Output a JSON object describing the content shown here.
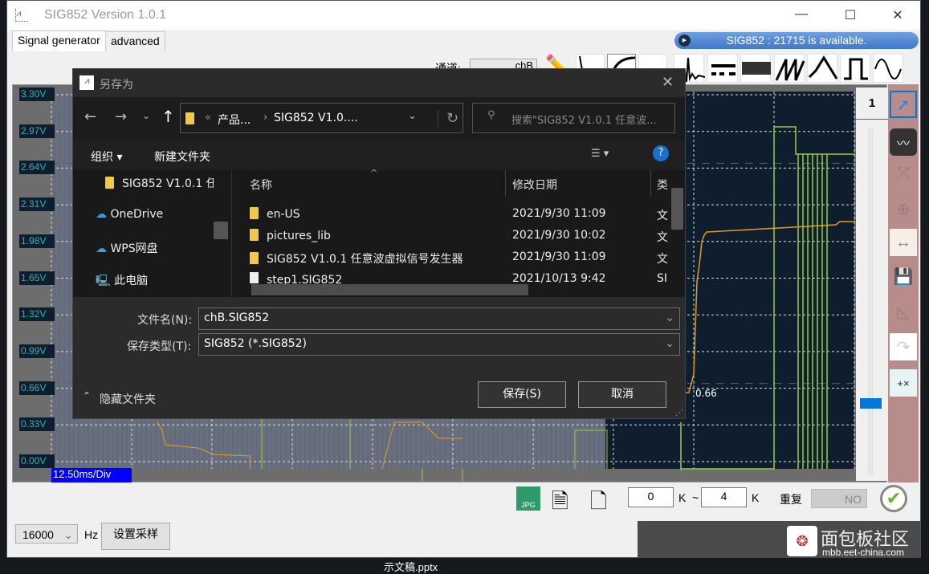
{
  "window": {
    "title": "SIG852  Version 1.0.1",
    "minimize": "—",
    "maximize": "☐",
    "close": "✕"
  },
  "tabs": [
    {
      "label": "Signal generator",
      "active": true
    },
    {
      "label": "advanced",
      "active": false
    }
  ],
  "banner": {
    "text": "SIG852 : 21715 is available."
  },
  "toolbar": {
    "channel_label": "通道:",
    "channel_value": "chB",
    "waveforms": [
      "noise-pulse",
      "dc",
      "noise",
      "sawtooth",
      "triangle",
      "square",
      "sine"
    ]
  },
  "chart": {
    "y_labels": [
      "3.30V",
      "2.97V",
      "2.64V",
      "2.31V",
      "1.98V",
      "1.65V",
      "1.32V",
      "0.99V",
      "0.66V",
      "0.33V",
      "0.00V"
    ],
    "timebase": "12.50ms/Div",
    "marker_value": "0.66",
    "page": "1",
    "colors": {
      "background": "#0f1e2e",
      "trace_a": "#e89a1a",
      "trace_b": "#9acd32"
    }
  },
  "dialog": {
    "title": "另存为",
    "breadcrumb": [
      "产品...",
      "SIG852 V1.0...."
    ],
    "search_placeholder": "搜索\"SIG852 V1.0.1 任意波...",
    "organize": "组织 ▾",
    "new_folder": "新建文件夹",
    "help": "?",
    "nav": [
      "SIG852 V1.0.1 任",
      "OneDrive",
      "WPS网盘",
      "此电脑"
    ],
    "columns": [
      "名称",
      "修改日期",
      "类"
    ],
    "files": [
      {
        "name": "en-US",
        "date": "2021/9/30 11:09",
        "type": "文",
        "kind": "folder"
      },
      {
        "name": "pictures_lib",
        "date": "2021/9/30 10:02",
        "type": "文",
        "kind": "folder"
      },
      {
        "name": "SIG852 V1.0.1 任意波虚拟信号发生器",
        "date": "2021/9/30 11:09",
        "type": "文",
        "kind": "folder"
      },
      {
        "name": "step1.SIG852",
        "date": "2021/10/13 9:42",
        "type": "SI",
        "kind": "file"
      }
    ],
    "filename_label": "文件名(N):",
    "filename_value": "chB.SIG852",
    "filetype_label": "保存类型(T):",
    "filetype_value": "SIG852 (*.SIG852)",
    "hide_folders": "隐藏文件夹",
    "save": "保存(S)",
    "cancel": "取消"
  },
  "bottom": {
    "from_value": "0",
    "from_unit": "K",
    "tilde": "~",
    "to_value": "4",
    "to_unit": "K",
    "repeat_label": "重复",
    "repeat_value": "NO"
  },
  "sampling": {
    "rate": "16000",
    "unit": "Hz",
    "set_button": "设置采样"
  },
  "watermark": {
    "text": "面包板社区",
    "url": "mbb.eet-china.com"
  },
  "desktop_text": "示文稿.pptx"
}
